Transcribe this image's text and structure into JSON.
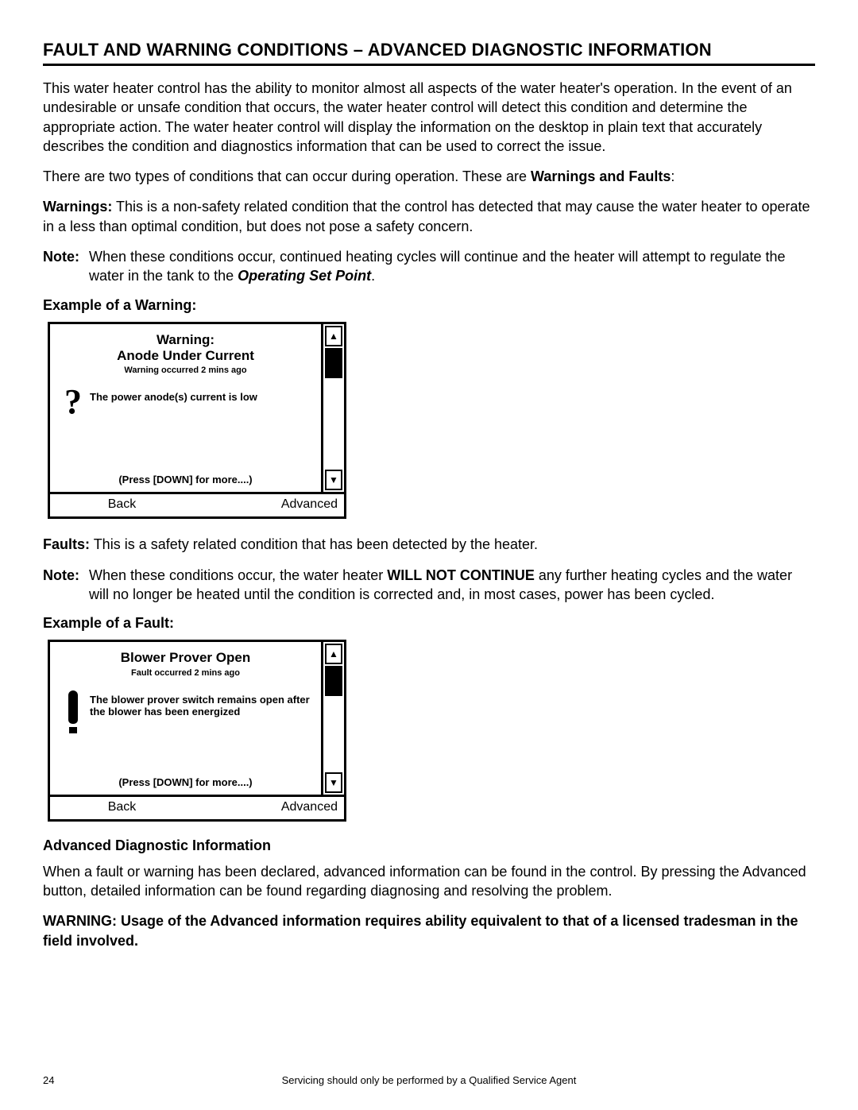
{
  "title": "FAULT AND WARNING CONDITIONS – ADVANCED DIAGNOSTIC INFORMATION",
  "intro": "This water heater control has the ability to monitor almost all aspects of the water heater's operation. In the event of an undesirable or unsafe condition that occurs, the water heater control will detect this condition and determine the appropriate action. The water heater control will display the information on the desktop in plain text that accurately describes the condition and diagnostics information that can be used to correct the issue.",
  "two_types_pre": "There are two types of conditions that can occur during operation. These are ",
  "two_types_bold": "Warnings and Faults",
  "two_types_post": ":",
  "warnings_label": "Warnings:",
  "warnings_body": " This is a non-safety related condition that the control has detected that may cause the water heater to operate in a less than optimal condition, but does not pose a safety concern.",
  "note_label": "Note:",
  "warnings_note_a": "When these conditions occur, continued heating cycles will continue and the heater will attempt to regulate the water in the tank to the ",
  "warnings_note_ital": "Operating Set Point",
  "warnings_note_b": ".",
  "example_warning": "Example of a Warning:",
  "lcd1": {
    "title1": "Warning:",
    "title2": "Anode Under Current",
    "sub": "Warning occurred 2 mins ago",
    "desc": "The power anode(s) current is low",
    "more": "(Press [DOWN] for more....)",
    "back": "Back",
    "advanced": "Advanced"
  },
  "faults_label": "Faults:",
  "faults_body": " This is a safety related condition that has been detected by the heater.",
  "faults_note_a": "When these conditions occur, the water heater ",
  "faults_note_bold": "WILL NOT CONTINUE",
  "faults_note_b": " any further heating cycles and the water will no longer be heated until the condition is corrected and, in most cases, power has been cycled.",
  "example_fault": "Example of a Fault:",
  "lcd2": {
    "title": "Blower Prover Open",
    "sub": "Fault  occurred 2 mins ago",
    "desc": "The blower prover switch remains open after the blower has been energized",
    "more": "(Press [DOWN] for more....)",
    "back": "Back",
    "advanced": "Advanced"
  },
  "adv_head": "Advanced Diagnostic Information",
  "adv_body": "When a fault or warning has been declared, advanced information can be found in the control. By pressing the Advanced button, detailed information can be found regarding diagnosing and resolving the problem.",
  "adv_warn": "WARNING: Usage of the Advanced information requires ability equivalent to that of a licensed tradesman in the field involved.",
  "page_number": "24",
  "footer_text": "Servicing should only be performed by a Qualified Service Agent"
}
